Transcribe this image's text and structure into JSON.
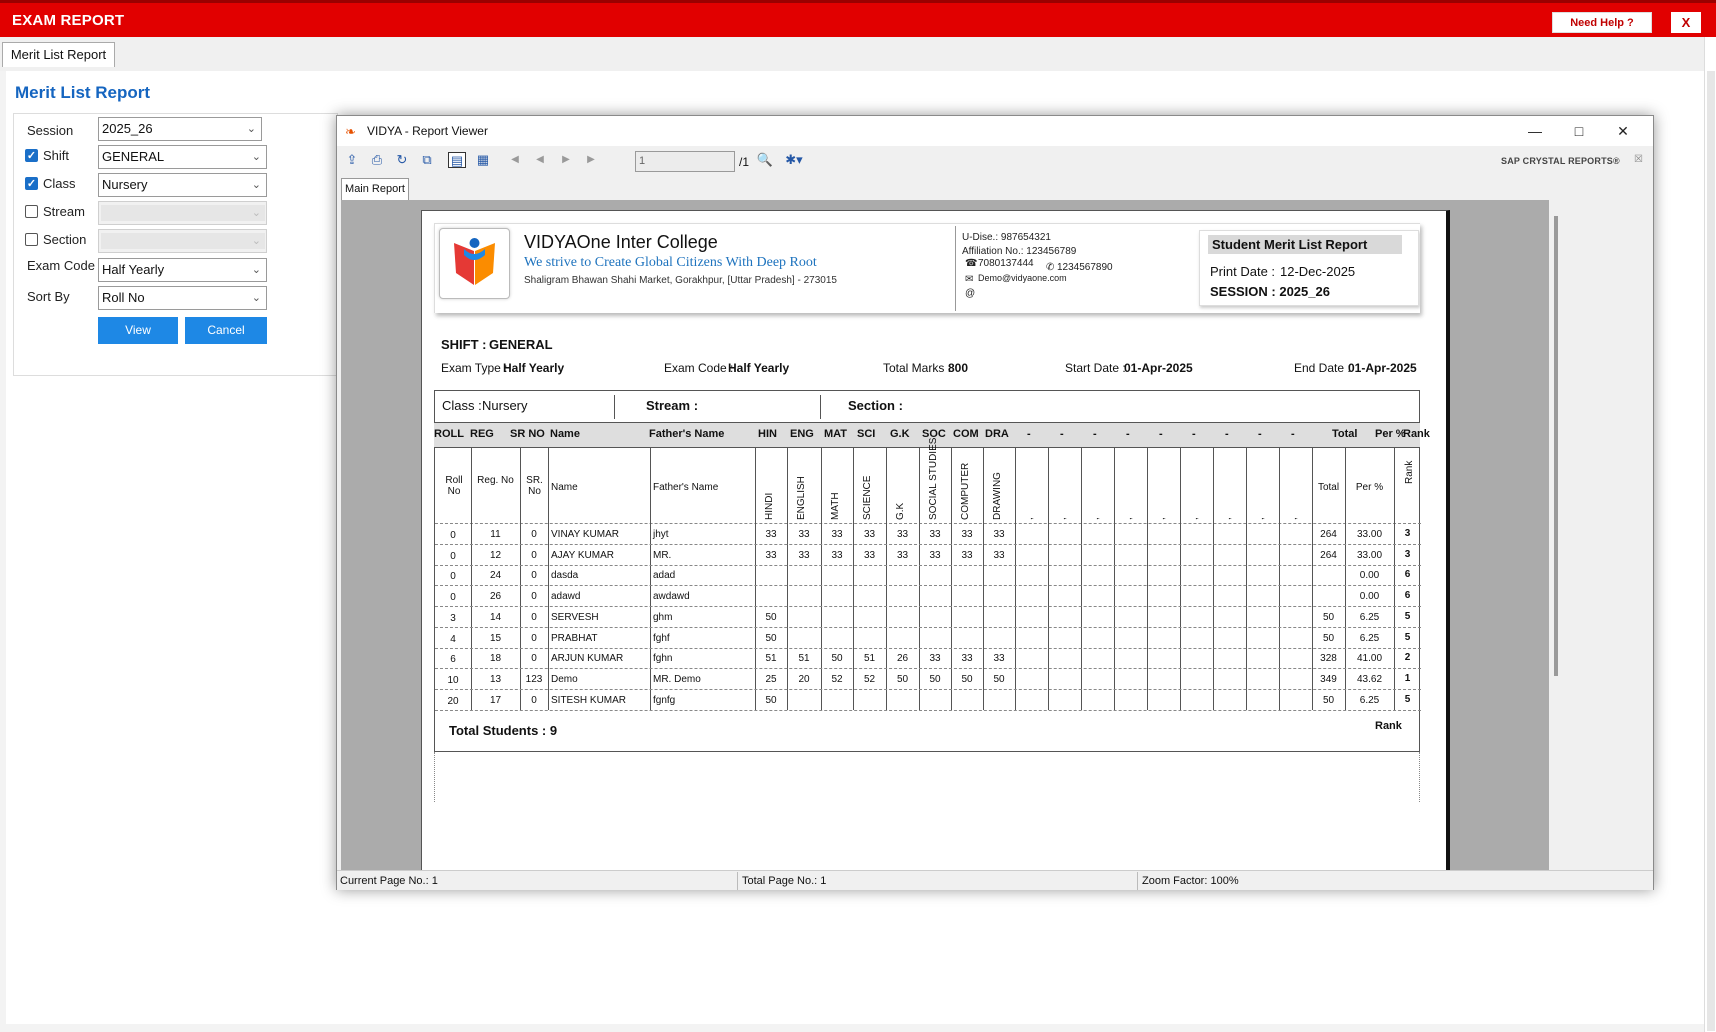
{
  "app": {
    "title": "EXAM REPORT",
    "help_label": "Need Help ?",
    "close_label": "X"
  },
  "tabs": [
    {
      "label": "Merit List Report"
    }
  ],
  "page": {
    "heading": "Merit List Report"
  },
  "form": {
    "session": {
      "label": "Session",
      "value": "2025_26"
    },
    "shift": {
      "label": "Shift",
      "value": "GENERAL",
      "checked": true
    },
    "class": {
      "label": "Class",
      "value": "Nursery",
      "checked": true
    },
    "stream": {
      "label": "Stream",
      "value": "",
      "checked": false
    },
    "section": {
      "label": "Section",
      "value": "",
      "checked": false
    },
    "exam_code": {
      "label": "Exam Code",
      "value": "Half Yearly"
    },
    "sort_by": {
      "label": "Sort By",
      "value": "Roll No"
    },
    "view_label": "View",
    "cancel_label": "Cancel"
  },
  "viewer": {
    "title": "VIDYA - Report Viewer",
    "page_input": "1",
    "page_total": "/1",
    "brand": "SAP CRYSTAL REPORTS®",
    "tab_label": "Main Report",
    "status": {
      "current": "Current Page No.: 1",
      "total": "Total Page No.: 1",
      "zoom": "Zoom Factor: 100%"
    }
  },
  "report": {
    "school_name": "VIDYAOne Inter College",
    "tagline": "We strive to Create Global Citizens With Deep Root",
    "address": "Shaligram Bhawan Shahi Market, Gorakhpur, [Uttar Pradesh] - 273015",
    "udise": "U-Dise.: 987654321",
    "affiliation": "Affiliation No.: 123456789",
    "phone1": "7080137444",
    "phone2": "1234567890",
    "email": "Demo@vidyaone.com",
    "report_title": "Student Merit List Report",
    "print_date_label": "Print Date :",
    "print_date": "12-Dec-2025",
    "session_line": "SESSION : 2025_26",
    "shift_label": "SHIFT :",
    "shift_value": "GENERAL",
    "exam_type_label": "Exam Type :",
    "exam_type": "Half Yearly",
    "exam_code_label": "Exam Code :",
    "exam_code": "Half Yearly",
    "total_marks_label": "Total Marks :",
    "total_marks": "800",
    "start_date_label": "Start Date :",
    "start_date": "01-Apr-2025",
    "end_date_label": "End Date :",
    "end_date": "01-Apr-2025",
    "class_label": "Class :",
    "class_value": "Nursery",
    "stream_label": "Stream :",
    "section_label": "Section :",
    "header_cols": [
      "ROLL",
      "REG",
      "SR NO",
      "Name",
      "Father's Name",
      "HIN",
      "ENG",
      "MAT",
      "SCI",
      "G.K",
      "SOC",
      "COM",
      "DRA",
      "-",
      "-",
      "-",
      "-",
      "-",
      "-",
      "-",
      "-",
      "-",
      "Total",
      "Per %",
      "Rank"
    ],
    "sub_cols": [
      "Roll No",
      "Reg. No",
      "SR. No",
      "Name",
      "Father's  Name",
      "Total",
      "Per %",
      "Rank"
    ],
    "subject_names": [
      "HINDI",
      "ENGLISH",
      "MATH",
      "SCIENCE",
      "G.K",
      "SOCIAL STUDIES",
      "COMPUTER",
      "DRAWING",
      ",",
      ",",
      ",",
      ",",
      ",",
      ",",
      ",",
      ",",
      ","
    ],
    "rows": [
      {
        "roll": "0",
        "reg": "11",
        "sr": "0",
        "name": "VINAY KUMAR",
        "father": "jhyt",
        "marks": [
          "33",
          "33",
          "33",
          "33",
          "33",
          "33",
          "33",
          "33"
        ],
        "total": "264",
        "per": "33.00",
        "rank": "3"
      },
      {
        "roll": "0",
        "reg": "12",
        "sr": "0",
        "name": "AJAY KUMAR",
        "father": "MR.",
        "marks": [
          "33",
          "33",
          "33",
          "33",
          "33",
          "33",
          "33",
          "33"
        ],
        "total": "264",
        "per": "33.00",
        "rank": "3"
      },
      {
        "roll": "0",
        "reg": "24",
        "sr": "0",
        "name": "dasda",
        "father": "adad",
        "marks": [
          "",
          "",
          "",
          "",
          "",
          "",
          "",
          ""
        ],
        "total": "",
        "per": "0.00",
        "rank": "6"
      },
      {
        "roll": "0",
        "reg": "26",
        "sr": "0",
        "name": "adawd",
        "father": "awdawd",
        "marks": [
          "",
          "",
          "",
          "",
          "",
          "",
          "",
          ""
        ],
        "total": "",
        "per": "0.00",
        "rank": "6"
      },
      {
        "roll": "3",
        "reg": "14",
        "sr": "0",
        "name": "SERVESH",
        "father": "ghm",
        "marks": [
          "50",
          "",
          "",
          "",
          "",
          "",
          "",
          ""
        ],
        "total": "50",
        "per": "6.25",
        "rank": "5"
      },
      {
        "roll": "4",
        "reg": "15",
        "sr": "0",
        "name": "PRABHAT",
        "father": "fghf",
        "marks": [
          "50",
          "",
          "",
          "",
          "",
          "",
          "",
          ""
        ],
        "total": "50",
        "per": "6.25",
        "rank": "5"
      },
      {
        "roll": "6",
        "reg": "18",
        "sr": "0",
        "name": "ARJUN KUMAR",
        "father": "fghn",
        "marks": [
          "51",
          "51",
          "50",
          "51",
          "26",
          "33",
          "33",
          "33"
        ],
        "total": "328",
        "per": "41.00",
        "rank": "2"
      },
      {
        "roll": "10",
        "reg": "13",
        "sr": "123",
        "name": "Demo",
        "father": "MR. Demo",
        "marks": [
          "25",
          "20",
          "52",
          "52",
          "50",
          "50",
          "50",
          "50"
        ],
        "total": "349",
        "per": "43.62",
        "rank": "1"
      },
      {
        "roll": "20",
        "reg": "17",
        "sr": "0",
        "name": "SITESH KUMAR",
        "father": "fgnfg",
        "marks": [
          "50",
          "",
          "",
          "",
          "",
          "",
          "",
          ""
        ],
        "total": "50",
        "per": "6.25",
        "rank": "5"
      }
    ],
    "total_students": "Total Students : 9",
    "rank_footer": "Rank"
  },
  "colors": {
    "brand_red": "#e10000",
    "accent_blue": "#1565c0",
    "button_blue": "#1e88e5"
  }
}
